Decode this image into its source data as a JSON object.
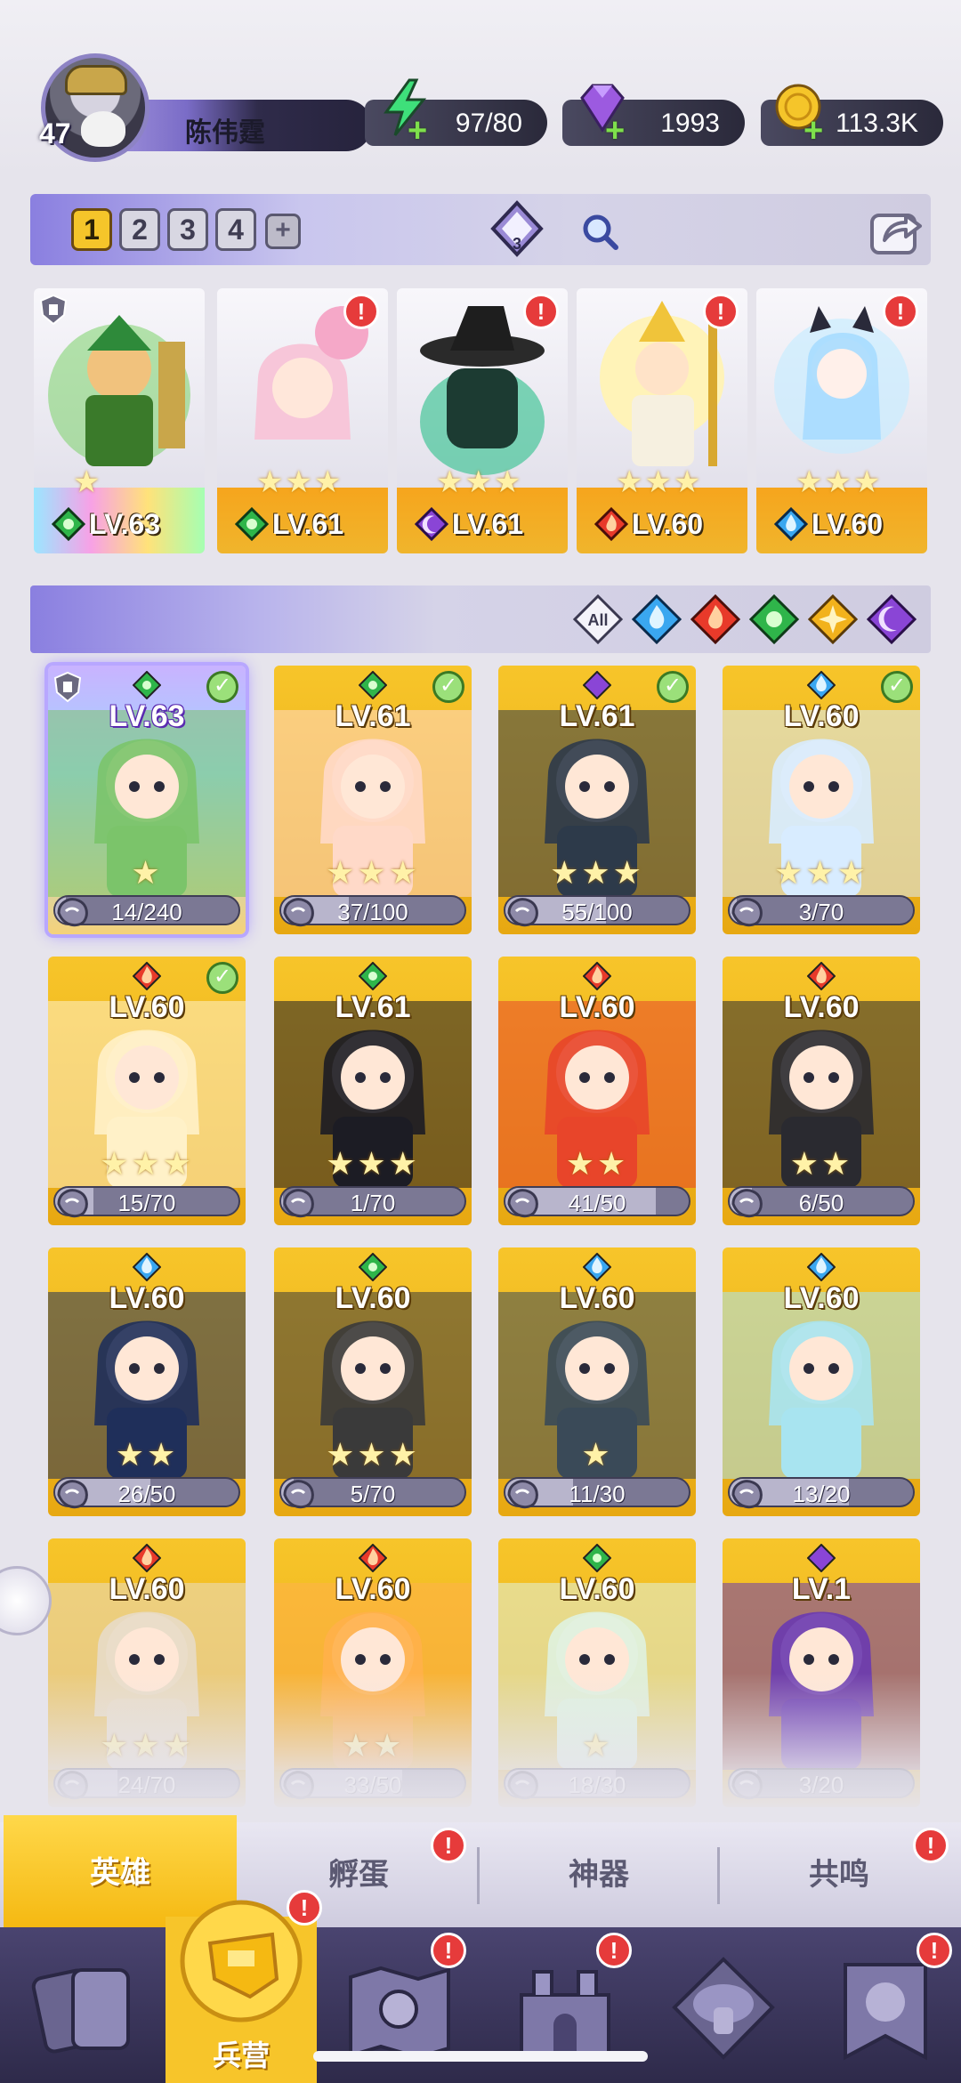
{
  "player": {
    "name": "陈伟霆",
    "level": "47"
  },
  "resources": {
    "energy": "97/80",
    "gems": "1993",
    "gold": "113.3K"
  },
  "teams": {
    "tabs": [
      "1",
      "2",
      "3",
      "4"
    ],
    "add": "+",
    "gem_count": "3"
  },
  "lineup": [
    {
      "level": "LV.63",
      "element": "nature",
      "alert": false,
      "stars": "★"
    },
    {
      "level": "LV.61",
      "element": "nature",
      "alert": true,
      "stars": "★★★"
    },
    {
      "level": "LV.61",
      "element": "dark",
      "alert": true,
      "stars": "★★★"
    },
    {
      "level": "LV.60",
      "element": "fire",
      "alert": true,
      "stars": "★★★"
    },
    {
      "level": "LV.60",
      "element": "water",
      "alert": true,
      "stars": "★★★"
    }
  ],
  "filters": {
    "all_label": "All",
    "elements": [
      "water",
      "fire",
      "nature",
      "light",
      "dark"
    ]
  },
  "heroes": [
    {
      "level": "LV.63",
      "element": "nature",
      "checked": true,
      "progress": "14/240",
      "frac": 0.06,
      "stars": "★"
    },
    {
      "level": "LV.61",
      "element": "nature",
      "checked": true,
      "progress": "37/100",
      "frac": 0.37,
      "stars": "★★★"
    },
    {
      "level": "LV.61",
      "element": "dark",
      "checked": true,
      "progress": "55/100",
      "frac": 0.55,
      "stars": "★★★"
    },
    {
      "level": "LV.60",
      "element": "water",
      "checked": true,
      "progress": "3/70",
      "frac": 0.04,
      "stars": "★★★"
    },
    {
      "level": "LV.60",
      "element": "fire",
      "checked": true,
      "progress": "15/70",
      "frac": 0.21,
      "stars": "★★★"
    },
    {
      "level": "LV.61",
      "element": "nature",
      "checked": false,
      "progress": "1/70",
      "frac": 0.01,
      "stars": "★★★"
    },
    {
      "level": "LV.60",
      "element": "fire",
      "checked": false,
      "progress": "41/50",
      "frac": 0.82,
      "stars": "★★"
    },
    {
      "level": "LV.60",
      "element": "fire",
      "checked": false,
      "progress": "6/50",
      "frac": 0.12,
      "stars": "★★"
    },
    {
      "level": "LV.60",
      "element": "water",
      "checked": false,
      "progress": "26/50",
      "frac": 0.52,
      "stars": "★★"
    },
    {
      "level": "LV.60",
      "element": "nature",
      "checked": false,
      "progress": "5/70",
      "frac": 0.07,
      "stars": "★★★"
    },
    {
      "level": "LV.60",
      "element": "water",
      "checked": false,
      "progress": "11/30",
      "frac": 0.37,
      "stars": "★"
    },
    {
      "level": "LV.60",
      "element": "water",
      "checked": false,
      "progress": "13/20",
      "frac": 0.65,
      "stars": ""
    },
    {
      "level": "LV.60",
      "element": "fire",
      "checked": false,
      "progress": "24/70",
      "frac": 0.34,
      "stars": "★★★"
    },
    {
      "level": "LV.60",
      "element": "fire",
      "checked": false,
      "progress": "33/50",
      "frac": 0.66,
      "stars": "★★"
    },
    {
      "level": "LV.60",
      "element": "nature",
      "checked": false,
      "progress": "18/30",
      "frac": 0.6,
      "stars": "★"
    },
    {
      "level": "LV.1",
      "element": "dark",
      "checked": false,
      "progress": "3/20",
      "frac": 0.15,
      "stars": ""
    }
  ],
  "subtabs": [
    "英雄",
    "孵蛋",
    "神器",
    "共鸣"
  ],
  "nav": {
    "barracks_label": "兵营"
  },
  "colors": {
    "water": "#3aa7f0",
    "fire": "#e83a2a",
    "nature": "#2fb54a",
    "light": "#f2b21c",
    "dark": "#8a45d6",
    "accent": "#f5c52a",
    "alert": "#e63b3b"
  }
}
